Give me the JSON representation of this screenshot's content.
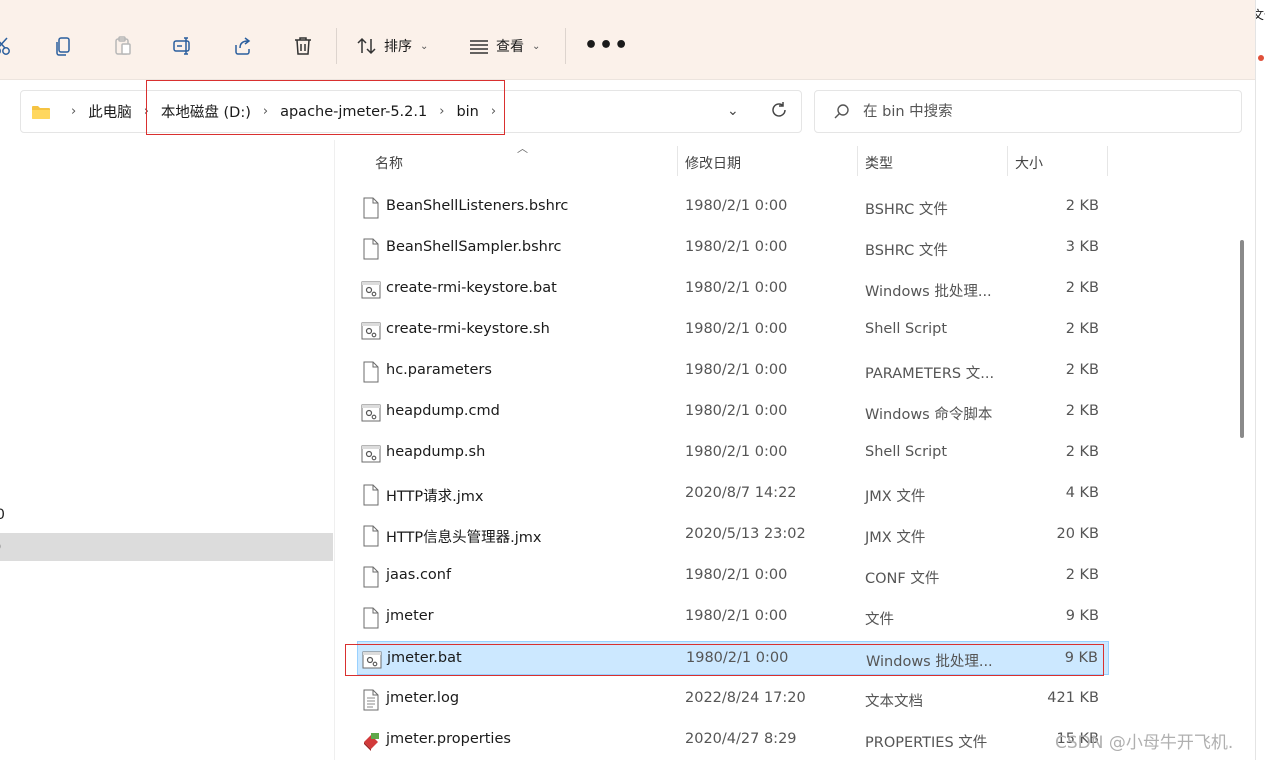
{
  "toolbar": {
    "sort_label": "排序",
    "view_label": "查看",
    "more_label": "•••"
  },
  "right_edge_text": "文件",
  "address": {
    "crumbs": [
      "此电脑",
      "本地磁盘 (D:)",
      "apache-jmeter-5.2.1",
      "bin"
    ]
  },
  "search": {
    "placeholder": "在 bin 中搜索"
  },
  "nav": {
    "frag1": "0",
    "frag2": ")"
  },
  "columns": {
    "name": "名称",
    "date": "修改日期",
    "type": "类型",
    "size": "大小"
  },
  "files": [
    {
      "name": "BeanShellListeners.bshrc",
      "date": "1980/2/1 0:00",
      "type": "BSHRC 文件",
      "size": "2 KB",
      "icon": "file-icon"
    },
    {
      "name": "BeanShellSampler.bshrc",
      "date": "1980/2/1 0:00",
      "type": "BSHRC 文件",
      "size": "3 KB",
      "icon": "file-icon"
    },
    {
      "name": "create-rmi-keystore.bat",
      "date": "1980/2/1 0:00",
      "type": "Windows 批处理...",
      "size": "2 KB",
      "icon": "script-icon"
    },
    {
      "name": "create-rmi-keystore.sh",
      "date": "1980/2/1 0:00",
      "type": "Shell Script",
      "size": "2 KB",
      "icon": "script-icon"
    },
    {
      "name": "hc.parameters",
      "date": "1980/2/1 0:00",
      "type": "PARAMETERS 文...",
      "size": "2 KB",
      "icon": "file-icon"
    },
    {
      "name": "heapdump.cmd",
      "date": "1980/2/1 0:00",
      "type": "Windows 命令脚本",
      "size": "2 KB",
      "icon": "script-icon"
    },
    {
      "name": "heapdump.sh",
      "date": "1980/2/1 0:00",
      "type": "Shell Script",
      "size": "2 KB",
      "icon": "script-icon"
    },
    {
      "name": "HTTP请求.jmx",
      "date": "2020/8/7 14:22",
      "type": "JMX 文件",
      "size": "4 KB",
      "icon": "file-icon"
    },
    {
      "name": "HTTP信息头管理器.jmx",
      "date": "2020/5/13 23:02",
      "type": "JMX 文件",
      "size": "20 KB",
      "icon": "file-icon"
    },
    {
      "name": "jaas.conf",
      "date": "1980/2/1 0:00",
      "type": "CONF 文件",
      "size": "2 KB",
      "icon": "file-icon"
    },
    {
      "name": "jmeter",
      "date": "1980/2/1 0:00",
      "type": "文件",
      "size": "9 KB",
      "icon": "file-icon"
    },
    {
      "name": "jmeter.bat",
      "date": "1980/2/1 0:00",
      "type": "Windows 批处理...",
      "size": "9 KB",
      "icon": "script-icon",
      "selected": true
    },
    {
      "name": "jmeter.log",
      "date": "2022/8/24 17:20",
      "type": "文本文档",
      "size": "421 KB",
      "icon": "text-file-icon"
    },
    {
      "name": "jmeter.properties",
      "date": "2020/4/27 8:29",
      "type": "PROPERTIES 文件",
      "size": "15 KB",
      "icon": "properties-icon"
    }
  ],
  "watermark": "CSDN @小母牛开飞机.",
  "colors": {
    "toolbar_bg": "#fbf1ea",
    "selected_row": "#cce8ff",
    "highlight_box": "#d9302f"
  }
}
